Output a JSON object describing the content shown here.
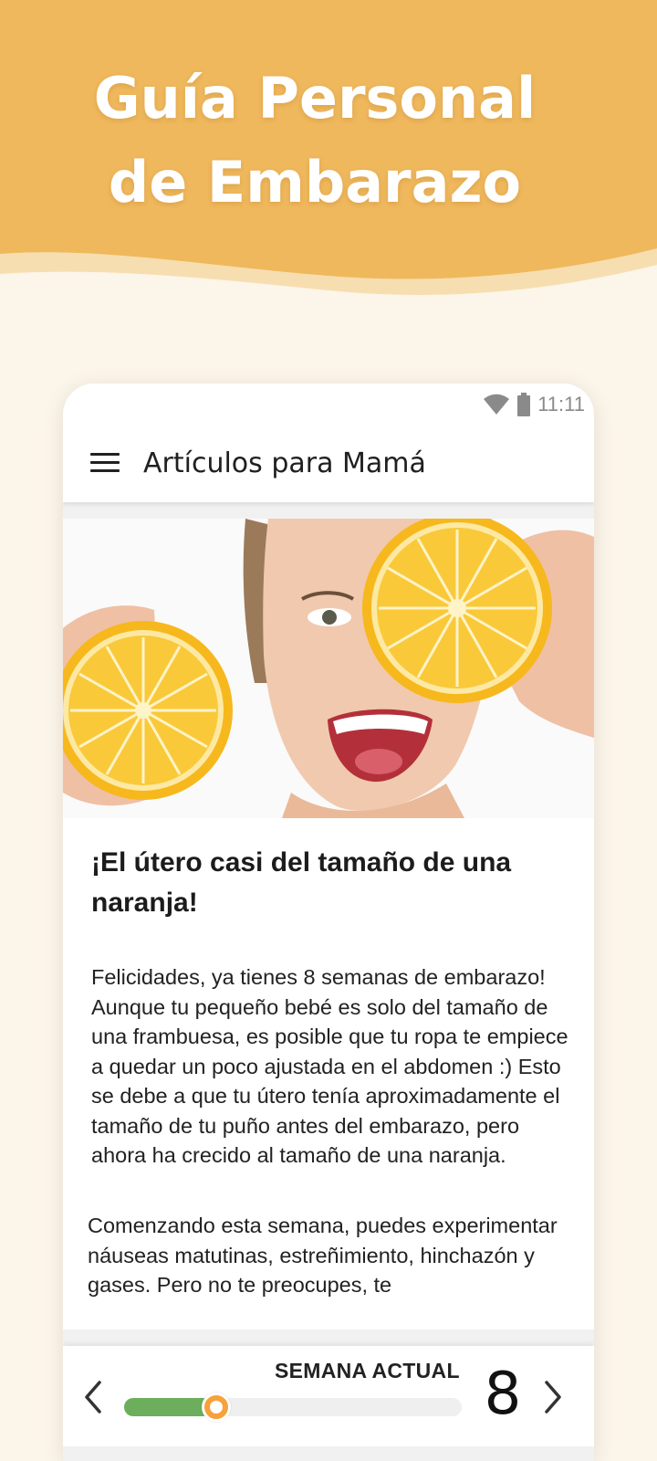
{
  "promo": {
    "title_line1": "Guía Personal",
    "title_line2": "de Embarazo"
  },
  "colors": {
    "header_orange": "#f0b85c",
    "wave_light": "#f7deb0",
    "page_bg": "#fcf5e9",
    "progress_green": "#6cae5c",
    "thumb_orange": "#f7a13a"
  },
  "status_bar": {
    "time": "11:11",
    "icons": [
      "wifi-icon",
      "battery-icon"
    ]
  },
  "app_bar": {
    "menu_icon": "hamburger-menu-icon",
    "title": "Artículos para Mamá"
  },
  "article": {
    "image_desc_icon": "orange-photo",
    "title": "¡El útero casi del tamaño de una naranja!",
    "paragraph1": "Felicidades, ya tienes 8 semanas de embarazo! Aunque tu pequeño bebé es solo del tamaño de una frambuesa, es posible que tu ropa te empiece a quedar un poco ajustada en el abdomen :) Esto se debe a que tu útero tenía aproximadamente el tamaño de tu puño antes del embarazo, pero ahora ha crecido al tamaño de una naranja.",
    "paragraph2": "Comenzando esta semana, puedes experimentar náuseas matutinas, estreñimiento, hinchazón y gases. Pero no te preocupes, te"
  },
  "week_selector": {
    "label": "SEMANA ACTUAL",
    "number": "8",
    "progress": 0.24,
    "prev_icon": "chevron-left-icon",
    "next_icon": "chevron-right-icon"
  }
}
